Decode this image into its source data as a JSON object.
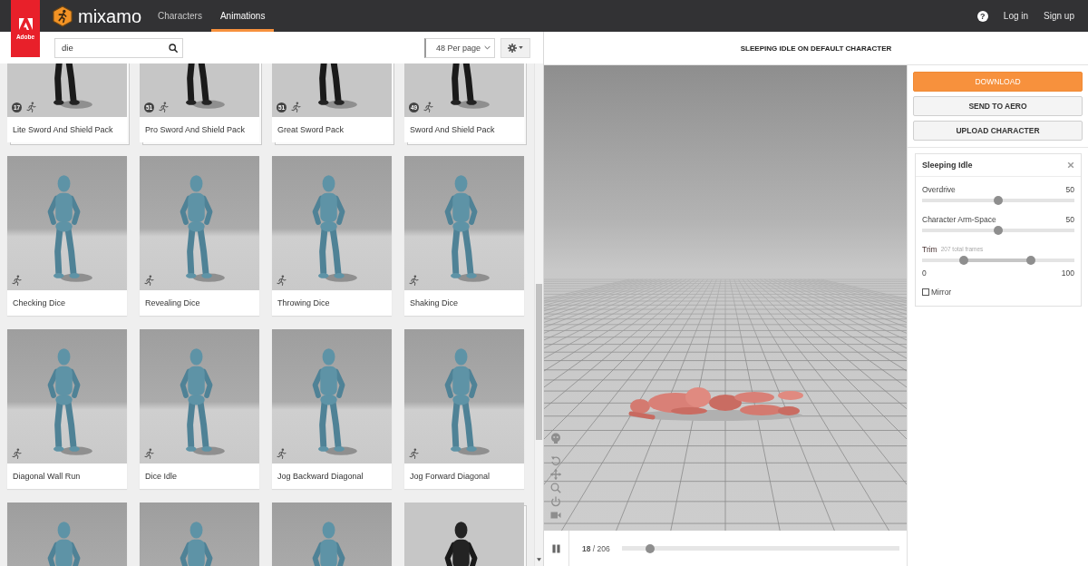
{
  "app_bar": {
    "brand": {
      "mark_text": "Adobe",
      "logo_text": "mixamo"
    },
    "nav": [
      {
        "label": "Characters",
        "selected": false
      },
      {
        "label": "Animations",
        "selected": true
      }
    ],
    "help": "?",
    "links": [
      "Log in",
      "Sign up"
    ]
  },
  "library": {
    "search": {
      "value": "die"
    },
    "per_page": "48 Per page",
    "cards": [
      {
        "kind": "pack",
        "title": "Lite Sword And Shield Pack",
        "count": "17"
      },
      {
        "kind": "pack",
        "title": "Pro Sword And Shield Pack",
        "count": "51"
      },
      {
        "kind": "pack",
        "title": "Great Sword Pack",
        "count": "51"
      },
      {
        "kind": "pack",
        "title": "Sword And Shield Pack",
        "count": "49"
      },
      {
        "kind": "animation",
        "title": "Checking Dice"
      },
      {
        "kind": "animation",
        "title": "Revealing Dice"
      },
      {
        "kind": "animation",
        "title": "Throwing Dice"
      },
      {
        "kind": "animation",
        "title": "Shaking Dice"
      },
      {
        "kind": "animation",
        "title": "Diagonal Wall Run"
      },
      {
        "kind": "animation",
        "title": "Dice Idle"
      },
      {
        "kind": "animation",
        "title": "Jog Backward Diagonal"
      },
      {
        "kind": "animation",
        "title": "Jog Forward Diagonal"
      },
      {
        "kind": "animation"
      },
      {
        "kind": "animation"
      },
      {
        "kind": "animation"
      },
      {
        "kind": "pack"
      }
    ]
  },
  "viewer": {
    "title": "SLEEPING IDLE ON DEFAULT CHARACTER",
    "playback": {
      "playing": true,
      "frame": "**18** / 206",
      "level": 0.09
    }
  },
  "actions": [
    {
      "kind": "primary",
      "label": "DOWNLOAD"
    },
    {
      "kind": "secondary",
      "label": "SEND TO AERO"
    },
    {
      "kind": "secondary",
      "label": "UPLOAD CHARACTER"
    }
  ],
  "animation_panel": {
    "title": "Sleeping Idle",
    "sliders": [
      {
        "kind": "slider",
        "label": "Overdrive",
        "value": "50",
        "level": 0.5
      },
      {
        "kind": "slider",
        "label": "Character Arm-Space",
        "value": "50",
        "level": 0.5
      },
      {
        "kind": "range",
        "label": "Trim",
        "note": "207 total frames",
        "handles": [
          {
            "level": 0.26
          },
          {
            "level": 0.73
          }
        ],
        "min_label": "0",
        "max_label": "100"
      }
    ],
    "mirror": {
      "label": "Mirror",
      "checked": false
    }
  }
}
